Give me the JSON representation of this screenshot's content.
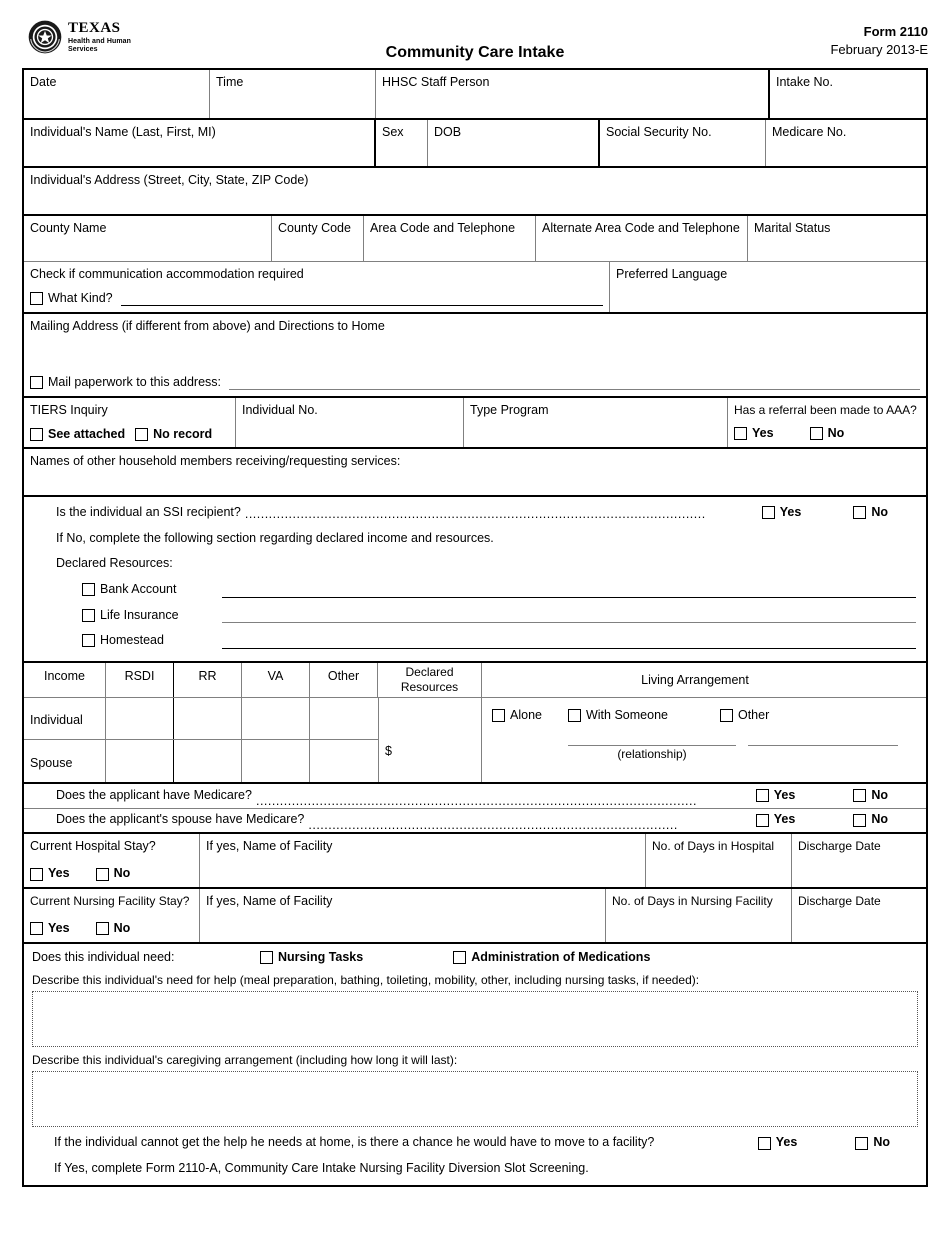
{
  "header": {
    "logo_texas": "TEXAS",
    "logo_line1": "Health and Human",
    "logo_line2": "Services",
    "logo_icon": "texas-hhs-seal",
    "form_number": "Form 2110",
    "form_date": "February 2013-E",
    "title": "Community Care Intake"
  },
  "row_identity": {
    "date": "Date",
    "time": "Time",
    "staff": "HHSC Staff Person",
    "intake_no": "Intake No."
  },
  "row_name": {
    "name": "Individual's Name (Last, First, MI)",
    "sex": "Sex",
    "dob": "DOB",
    "ssn": "Social Security No.",
    "medicare_no": "Medicare No."
  },
  "row_address": {
    "address": "Individual's Address (Street, City, State, ZIP Code)"
  },
  "row_county": {
    "county_name": "County Name",
    "county_code": "County Code",
    "area_code": "Area Code and Telephone",
    "alt_area_code": "Alternate Area Code and Telephone",
    "marital_status": "Marital Status"
  },
  "row_communication": {
    "check_label": "Check if communication accommodation required",
    "what_kind": "What Kind?",
    "preferred_language": "Preferred Language"
  },
  "row_mailing": {
    "mailing_label": "Mailing Address (if different from above) and Directions to Home",
    "mail_paperwork": "Mail paperwork to this address:"
  },
  "row_tiers": {
    "tiers_inquiry": "TIERS Inquiry",
    "see_attached": "See attached",
    "no_record": "No record",
    "individual_no": "Individual No.",
    "type_program": "Type Program",
    "referral_aaa": "Has a referral been made to AAA?",
    "yes": "Yes",
    "no": "No"
  },
  "row_household": {
    "label": "Names of other household members receiving/requesting services:"
  },
  "row_ssi": {
    "question": "Is the individual an SSI recipient?",
    "dots": "....................................................................................................................",
    "yes": "Yes",
    "no": "No",
    "if_no": "If No, complete the following section regarding declared income and resources.",
    "declared_resources": "Declared Resources:",
    "bank_account": "Bank Account",
    "life_insurance": "Life Insurance",
    "homestead": "Homestead"
  },
  "income_table": {
    "headers": [
      "Income",
      "RSDI",
      "RR",
      "VA",
      "Other",
      "Declared Resources",
      "Living Arrangement"
    ],
    "declared_header_line1": "Declared",
    "declared_header_line2": "Resources",
    "rows": [
      "Individual",
      "Spouse"
    ],
    "currency": "$",
    "living_options": [
      "Alone",
      "With Someone",
      "Other"
    ],
    "relationship": "(relationship)"
  },
  "medicare_questions": [
    {
      "question": "Does the applicant have Medicare?",
      "dots": "...............................................................................................................",
      "yes": "Yes",
      "no": "No"
    },
    {
      "question": "Does the applicant's spouse have Medicare?",
      "dots": ".............................................................................................",
      "yes": "Yes",
      "no": "No"
    }
  ],
  "hospital": {
    "question": "Current Hospital Stay?",
    "yes": "Yes",
    "no": "No",
    "facility": "If yes, Name of Facility",
    "days": "No. of Days in Hospital",
    "discharge": "Discharge Date"
  },
  "nursing_facility": {
    "question": "Current Nursing Facility Stay?",
    "yes": "Yes",
    "no": "No",
    "facility": "If yes, Name of Facility",
    "days": "No. of Days in Nursing Facility",
    "discharge": "Discharge Date"
  },
  "needs": {
    "prompt": "Does this individual need:",
    "nursing_tasks": "Nursing Tasks",
    "administration_meds": "Administration of Medications",
    "describe_help": "Describe this individual's need for help (meal preparation, bathing, toileting, mobility, other, including nursing tasks, if needed):",
    "describe_caregiving": "Describe this individual's caregiving arrangement (including how long it will last):",
    "help_value": "",
    "caregiving_value": ""
  },
  "facility_move": {
    "question": "If the individual cannot get the help he needs at home, is there a chance he would have to move to a facility?",
    "yes": "Yes",
    "no": "No",
    "note": "If Yes, complete Form 2110-A, Community Care Intake Nursing Facility Diversion Slot Screening."
  }
}
